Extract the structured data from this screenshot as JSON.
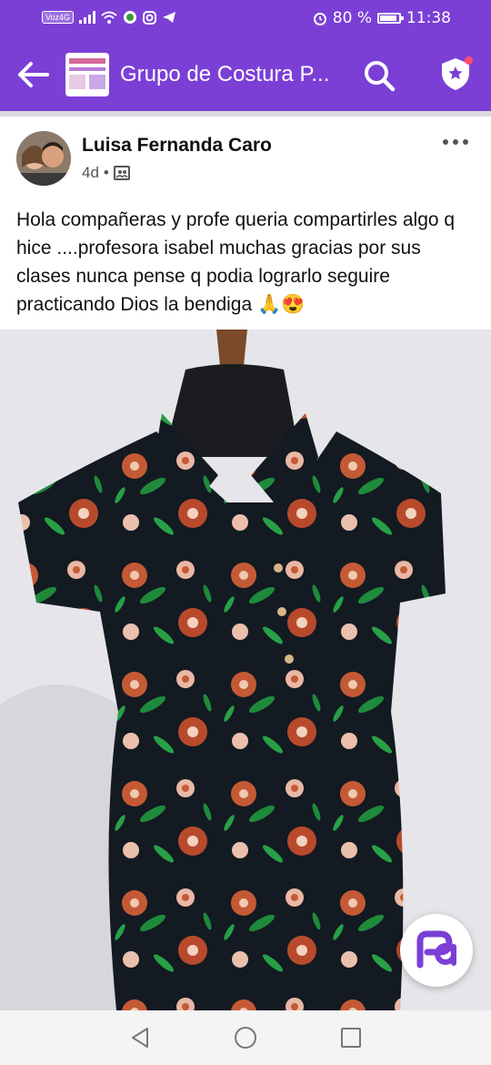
{
  "status_bar": {
    "volte": "Voz4G",
    "battery_text": "80 %",
    "battery_level": 0.8,
    "time": "11:38",
    "left_icons": [
      "signal-icon",
      "wifi-icon",
      "whatsapp-icon",
      "instagram-icon",
      "telegram-icon"
    ],
    "right_icons": [
      "alarm-icon",
      "battery-icon"
    ]
  },
  "app_bar": {
    "group_title": "Grupo de Costura P...",
    "icons": [
      "back-arrow-icon",
      "search-icon",
      "shield-star-icon"
    ],
    "color": "#7b3fd6",
    "notification_color": "#ff4b6e"
  },
  "post": {
    "author": "Luisa Fernanda Caro",
    "age": "4d",
    "separator": "•",
    "audience_icon": "group-members-icon",
    "body": "Hola compañeras y profe queria compartirles algo q hice ....profesora isabel muchas gracias por sus clases nunca pense q podia lograrlo seguire practicando Dios la bendiga 🙏😍"
  },
  "fab": {
    "icon": "pa-logo-icon"
  },
  "nav_bar": {
    "icons": [
      "back-triangle-icon",
      "home-circle-icon",
      "recents-square-icon"
    ]
  }
}
